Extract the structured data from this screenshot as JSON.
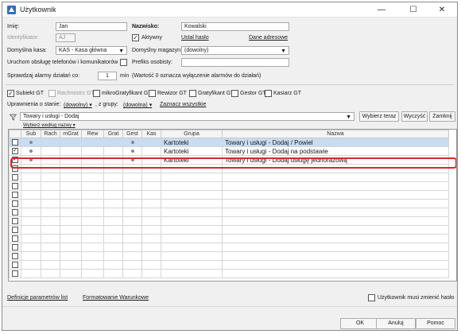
{
  "window": {
    "title": "Użytkownik",
    "minimize": "—",
    "maximize": "☐",
    "close": "✕"
  },
  "form": {
    "imie_label": "Imię:",
    "imie_value": "Jan",
    "nazwisko_label": "Nazwisko:",
    "nazwisko_value": "Kowalski",
    "ident_label": "Identyfikator:",
    "ident_value": "AJ",
    "aktywny_label": "Aktywny",
    "ustal_haslo": "Ustal hasło",
    "dane_adresowe": "Dane adresowe",
    "kasa_label": "Domyślna kasa:",
    "kasa_value": "KAS - Kasa główna",
    "magazyn_label": "Domyślny magazyn:",
    "magazyn_value": "(dowolny)",
    "telefon_label": "Uruchom obsługę telefonów i komunikatorów",
    "prefiks_label": "Prefiks osobisty:",
    "alarmy_label": "Sprawdzaj alarmy działań co:",
    "alarmy_value": "1",
    "alarmy_unit": "min",
    "alarmy_hint": "(Wartość 0 oznacza wyłączenie alarmów do działań)"
  },
  "roles": [
    {
      "label": "Subiekt GT",
      "checked": true,
      "disabled": false
    },
    {
      "label": "Rachmistrz GT",
      "checked": false,
      "disabled": true
    },
    {
      "label": "mikroGratyfikant GT",
      "checked": false,
      "disabled": false
    },
    {
      "label": "Rewizor GT",
      "checked": false,
      "disabled": false
    },
    {
      "label": "Gratyfikant GT",
      "checked": false,
      "disabled": false
    },
    {
      "label": "Gestor GT",
      "checked": false,
      "disabled": false
    },
    {
      "label": "Kasiarz GT",
      "checked": false,
      "disabled": false
    }
  ],
  "perm": {
    "label": "Uprawnienia o stanie:",
    "stan_value": "(dowolny)",
    "grupy_label": ", z grupy:",
    "grupy_value": "(dowolna)",
    "zaznacz": "Zaznacz wszystkie"
  },
  "filter": {
    "value": "Towary i usługi - Dodaj",
    "wybierz_teraz": "Wybierz teraz",
    "wyczysc": "Wyczyść",
    "zamknij": "Zamknij",
    "sort_label": "Wybierz według nazwy ▾"
  },
  "table": {
    "columns": [
      "",
      "Sub",
      "Rach",
      "mGrat",
      "Rew",
      "Grat",
      "Gest",
      "Kas",
      "Grupa",
      "Nazwa"
    ],
    "rows": [
      {
        "checked": false,
        "sub": true,
        "gest": true,
        "grupa": "Kartoteki",
        "nazwa": "Towary i usługi - Dodaj / Powiel",
        "selected": true
      },
      {
        "checked": true,
        "sub": true,
        "gest": true,
        "grupa": "Kartoteki",
        "nazwa": "Towary i usługi - Dodaj na podstawie",
        "selected": false
      },
      {
        "checked": true,
        "sub": true,
        "gest": true,
        "grupa": "Kartoteki",
        "nazwa": "Towary i usługi - Dodaj usługę jednorazową",
        "selected": false
      }
    ],
    "empty_rows": 13
  },
  "footer": {
    "definicje": "Definicje parametrów list",
    "formatowanie": "Formatowanie Warunkowe",
    "musi_zmienic": "Użytkownik musi zmienić hasło",
    "ok": "OK",
    "anuluj": "Anuluj",
    "pomoc": "Pomoc"
  },
  "colors": {
    "highlight": "#d9282f",
    "selected_row": "#c8dcf2"
  }
}
